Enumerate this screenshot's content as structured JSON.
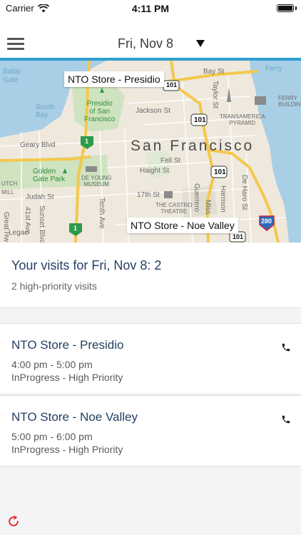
{
  "status_bar": {
    "carrier": "Carrier",
    "time": "4:11 PM"
  },
  "nav": {
    "date": "Fri, Nov 8"
  },
  "map": {
    "callouts": [
      "NTO Store - Presidio",
      "NTO Store - Noe Valley"
    ],
    "labels": {
      "city": "San Francisco",
      "baldy": "Baldy",
      "gate": "Gate",
      "south_bay": "South\nBay",
      "presidio": "Presidio\nof San\nFrancisco",
      "geary": "Geary Blvd",
      "jackson": "Jackson St",
      "bay_st": "Bay St",
      "golden_gate_park": "Golden\nGate Park",
      "de_young": "DE YOUNG\nMUSEUM",
      "haight": "Haight St",
      "fell": "Fell St",
      "judah": "Judah St",
      "seventeenth": "17th St",
      "castro": "THE CASTRO\nTHEATRE",
      "transamerica": "TRANSAMERICA\nPYRAMID",
      "ferry": "FERRY\nBUILDIN",
      "taylor": "Taylor St",
      "guerrero": "Guerrero",
      "harrison": "Harrison",
      "de_haro": "De Haro St",
      "sunset": "Sunset Blvd",
      "tenth": "Tenth Ave",
      "forty_first": "41st Ave",
      "mission": "Miss",
      "ferry_short": "Ferry",
      "utch": "UTCH",
      "mill": "MILL",
      "great_hw": "Great Hw",
      "legac": "Legac",
      "shield_101": "101",
      "shield_1": "1",
      "shield_280": "280"
    }
  },
  "summary": {
    "title": "Your visits for Fri, Nov 8: 2",
    "subtitle": "2 high-priority visits"
  },
  "visits": [
    {
      "name": "NTO Store - Presidio",
      "time": "4:00 pm - 5:00 pm",
      "status": "InProgress - High Priority"
    },
    {
      "name": "NTO Store - Noe Valley",
      "time": "5:00 pm - 6:00 pm",
      "status": "InProgress - High Priority"
    }
  ],
  "colors": {
    "accent": "#2e9fce",
    "title_text": "#243f63",
    "refresh": "#d9342b",
    "water": "#a9cfe6",
    "park": "#cfe3c0",
    "highway": "#f4c84c"
  }
}
